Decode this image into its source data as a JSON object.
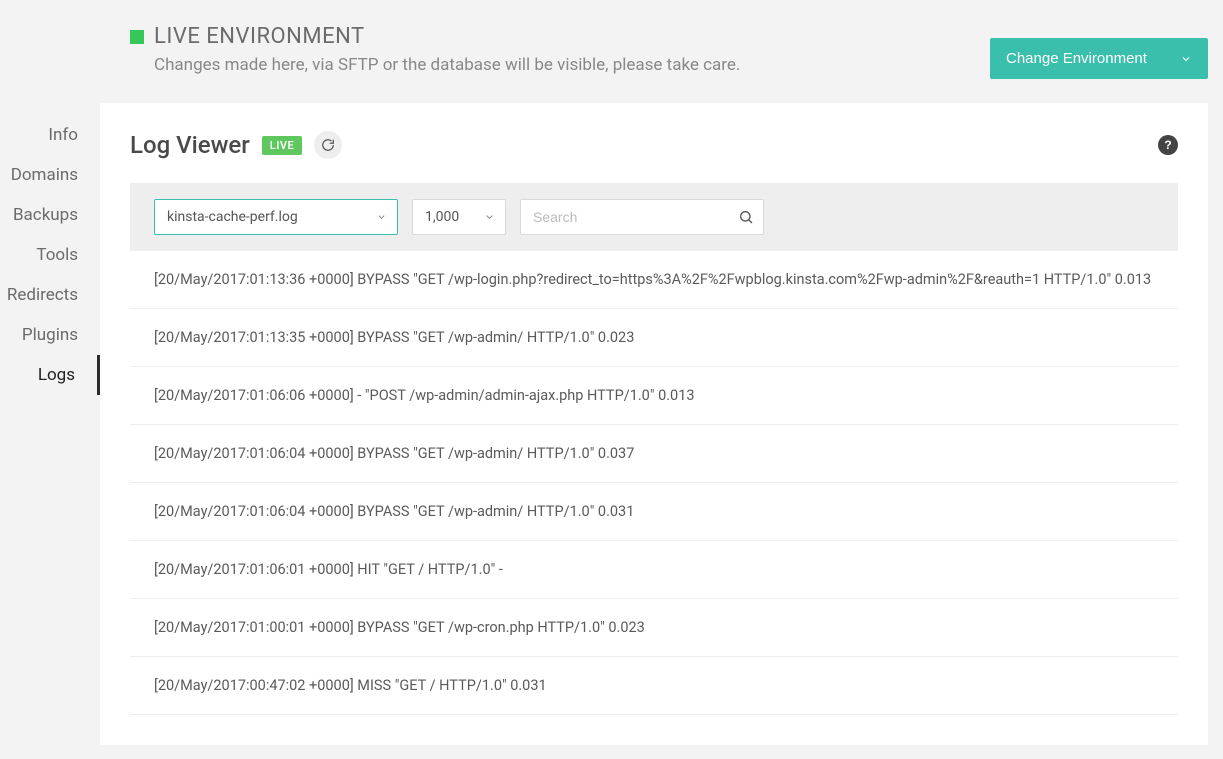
{
  "header": {
    "env_title": "LIVE ENVIRONMENT",
    "env_subtitle": "Changes made here, via SFTP or the database will be visible, please take care.",
    "change_env_label": "Change Environment"
  },
  "sidebar": {
    "items": [
      {
        "label": "Info"
      },
      {
        "label": "Domains"
      },
      {
        "label": "Backups"
      },
      {
        "label": "Tools"
      },
      {
        "label": "Redirects"
      },
      {
        "label": "Plugins"
      },
      {
        "label": "Logs"
      }
    ],
    "active_index": 6
  },
  "viewer": {
    "title": "Log Viewer",
    "badge": "LIVE",
    "help_label": "?",
    "file_select": "kinsta-cache-perf.log",
    "count_select": "1,000",
    "search_placeholder": "Search"
  },
  "log_entries": [
    "[20/May/2017:01:13:36 +0000] BYPASS \"GET /wp-login.php?redirect_to=https%3A%2F%2Fwpblog.kinsta.com%2Fwp-admin%2F&reauth=1 HTTP/1.0\" 0.013",
    "[20/May/2017:01:13:35 +0000] BYPASS \"GET /wp-admin/ HTTP/1.0\" 0.023",
    "[20/May/2017:01:06:06 +0000] - \"POST /wp-admin/admin-ajax.php HTTP/1.0\" 0.013",
    "[20/May/2017:01:06:04 +0000] BYPASS \"GET /wp-admin/ HTTP/1.0\" 0.037",
    "[20/May/2017:01:06:04 +0000] BYPASS \"GET /wp-admin/ HTTP/1.0\" 0.031",
    "[20/May/2017:01:06:01 +0000] HIT \"GET / HTTP/1.0\" -",
    "[20/May/2017:01:00:01 +0000] BYPASS \"GET /wp-cron.php HTTP/1.0\" 0.023",
    "[20/May/2017:00:47:02 +0000] MISS \"GET / HTTP/1.0\" 0.031"
  ],
  "colors": {
    "accent": "#3bbfad",
    "live_green": "#5ec85e"
  }
}
